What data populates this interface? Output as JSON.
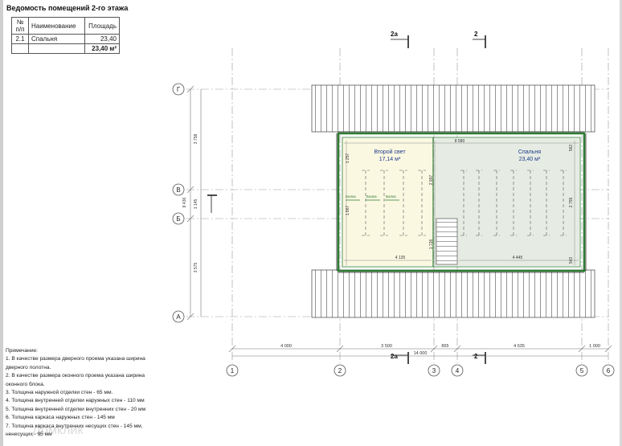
{
  "schedule": {
    "title": "Ведомость помещений 2-го этажа",
    "headers": [
      "№ п/п",
      "Наименование",
      "Площадь"
    ],
    "rows": [
      {
        "no": "2.1",
        "name": "Спальня",
        "area": "23,40"
      }
    ],
    "total": "23,40 м²"
  },
  "rooms": [
    {
      "name": "Второй свет",
      "area": "17,14 м²"
    },
    {
      "name": "Спальня",
      "area": "23,40 м²"
    }
  ],
  "grid_axes_v": [
    "1",
    "2",
    "3",
    "4",
    "5",
    "6"
  ],
  "grid_axes_h": [
    "Г",
    "В",
    "Б",
    "А"
  ],
  "section_marks": [
    "2а",
    "2"
  ],
  "dims": {
    "bottom": [
      "4 000",
      "3 500",
      "865",
      "4 635",
      "1 000"
    ],
    "bottom_total": "14 000",
    "left": [
      "3 758",
      "8 436",
      "1 145",
      "3 575"
    ],
    "inner_top": "8 580",
    "inner_bottom_left": "4 135",
    "inner_bottom_right": "4 445",
    "inner_mid": [
      "2 997",
      "1 726"
    ],
    "right": [
      "562",
      "2 755",
      "543"
    ],
    "left_wall": [
      "1 257",
      "1 867"
    ]
  },
  "beam_labels": [
    "Балка",
    "Балка",
    "Балка"
  ],
  "notes": [
    "Примечание:",
    "1. В качестве размера дверного проема указана ширина дверного полотна.",
    "2. В качестве размера оконного проема указана ширина оконного блока.",
    "3. Толщина наружной отделки стен - 65 мм.",
    "4. Толщина внутренней отделки наружных стен - 110 мм",
    "5. Толщина внутренней отделки внутренних стен - 20 мм",
    "6. Толщина каркаса наружных стен - 145 мм",
    "7. Толщина каркаса внутренних несущих стен - 145 мм, ненесущих - 95 мм"
  ],
  "watermark": "Домклик",
  "colors": {
    "wall_green": "#2e7d32",
    "bedroom_fill": "#e6ece3",
    "void_fill": "#fbf8e2",
    "room_text": "#1f3a8a"
  }
}
